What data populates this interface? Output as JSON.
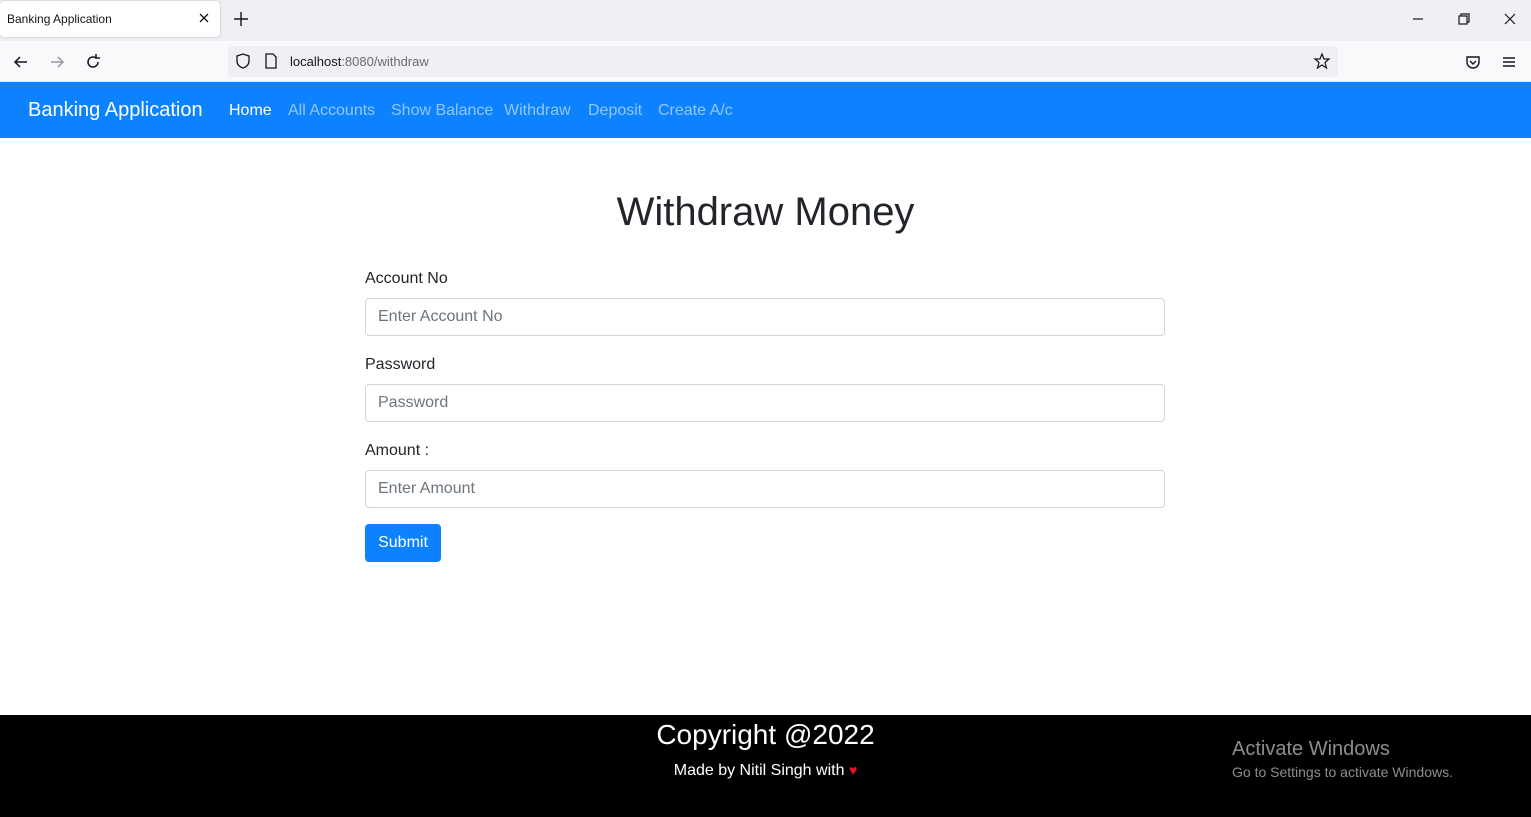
{
  "browser": {
    "tab_title": "Banking Application",
    "url_host": "localhost",
    "url_path": ":8080/withdraw"
  },
  "navbar": {
    "brand": "Banking Application",
    "links": [
      {
        "label": "Home",
        "active": true
      },
      {
        "label": "All Accounts",
        "active": false
      },
      {
        "label": "Show Balance",
        "active": false
      },
      {
        "label": "Withdraw",
        "active": false
      },
      {
        "label": "Deposit",
        "active": false
      },
      {
        "label": "Create A/c",
        "active": false
      }
    ]
  },
  "form": {
    "title": "Withdraw Money",
    "account_label": "Account No",
    "account_placeholder": "Enter Account No",
    "password_label": "Password",
    "password_placeholder": "Password",
    "amount_label": "Amount :",
    "amount_placeholder": "Enter Amount",
    "submit_label": "Submit"
  },
  "footer": {
    "copyright": "Copyright @2022",
    "made_by": "Made by Nitil Singh with",
    "heart": "♥"
  },
  "watermark": {
    "title": "Activate Windows",
    "subtitle": "Go to Settings to activate Windows."
  },
  "colors": {
    "primary": "#0d82ff",
    "footer_bg": "#000000",
    "heart": "#e8102d"
  }
}
